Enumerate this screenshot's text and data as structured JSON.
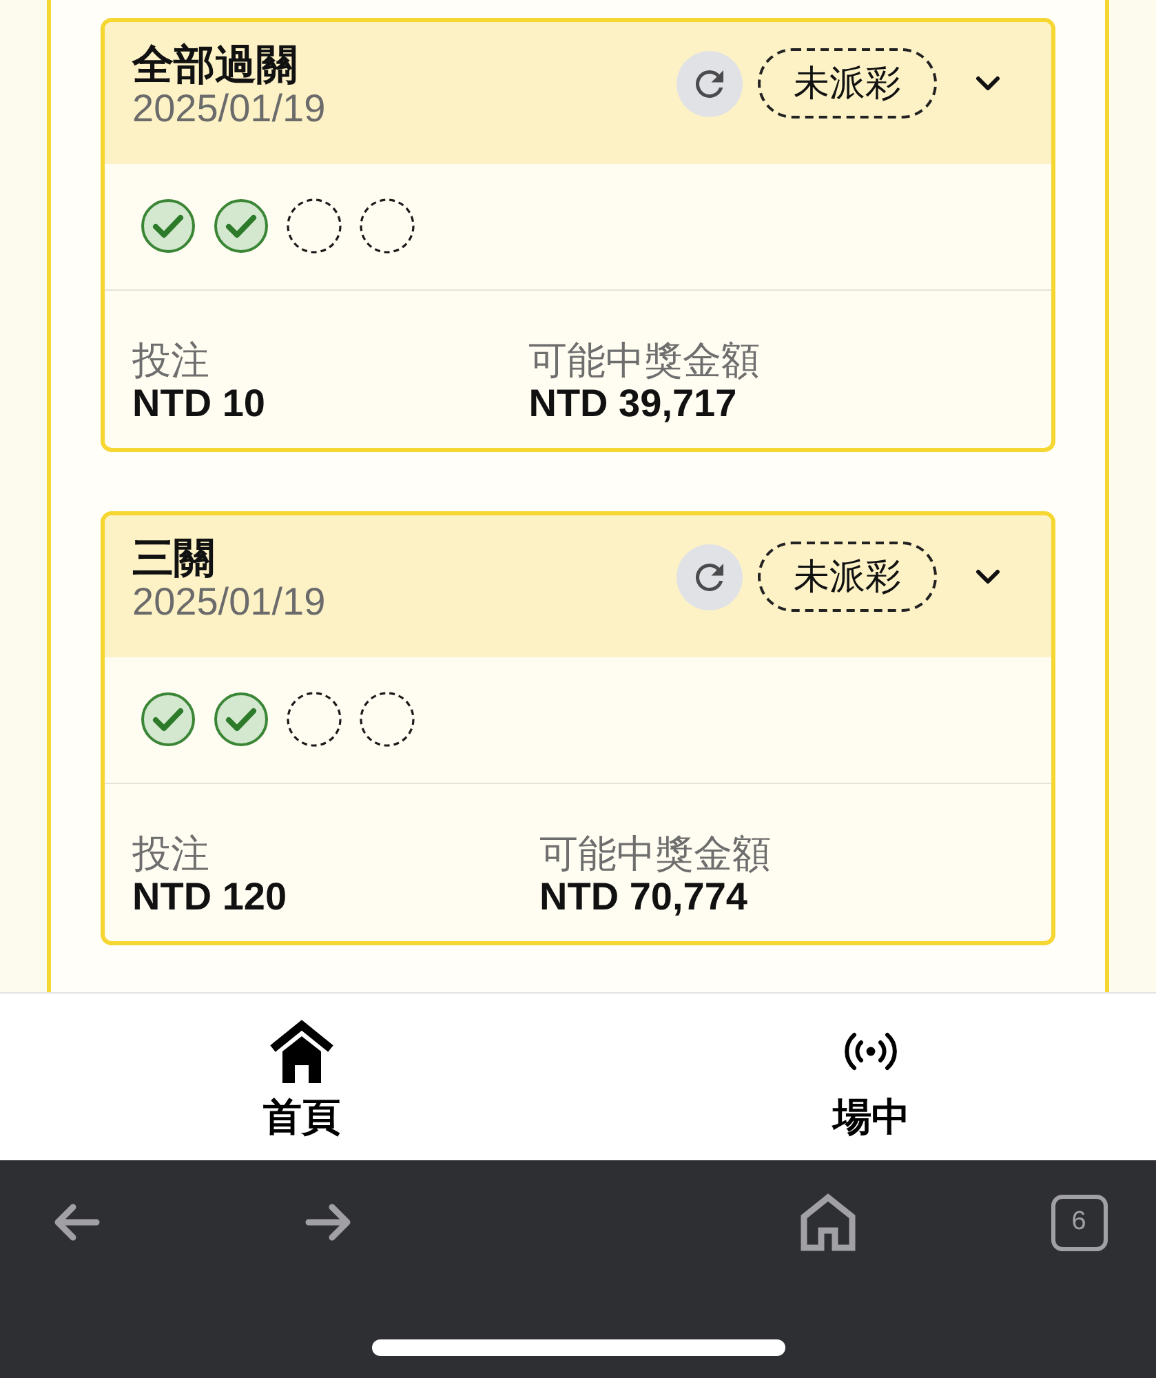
{
  "cards": [
    {
      "title": "全部過關",
      "date": "2025/01/19",
      "status": "未派彩",
      "legs": [
        {
          "won": true
        },
        {
          "won": true
        },
        {
          "won": false
        },
        {
          "won": false
        }
      ],
      "stake_label": "投注",
      "stake": "NTD 10",
      "payout_label": "可能中獎金額",
      "payout": "NTD 39,717"
    },
    {
      "title": "三關",
      "date": "2025/01/19",
      "status": "未派彩",
      "legs": [
        {
          "won": true
        },
        {
          "won": true
        },
        {
          "won": false
        },
        {
          "won": false
        }
      ],
      "stake_label": "投注",
      "stake": "NTD 120",
      "payout_label": "可能中獎金額",
      "payout": "NTD 70,774"
    }
  ],
  "bottom_nav": [
    {
      "label": "首頁",
      "kind": "home"
    },
    {
      "label": "場中",
      "kind": "live"
    }
  ],
  "browser_bar": {
    "tab_count": "6"
  }
}
